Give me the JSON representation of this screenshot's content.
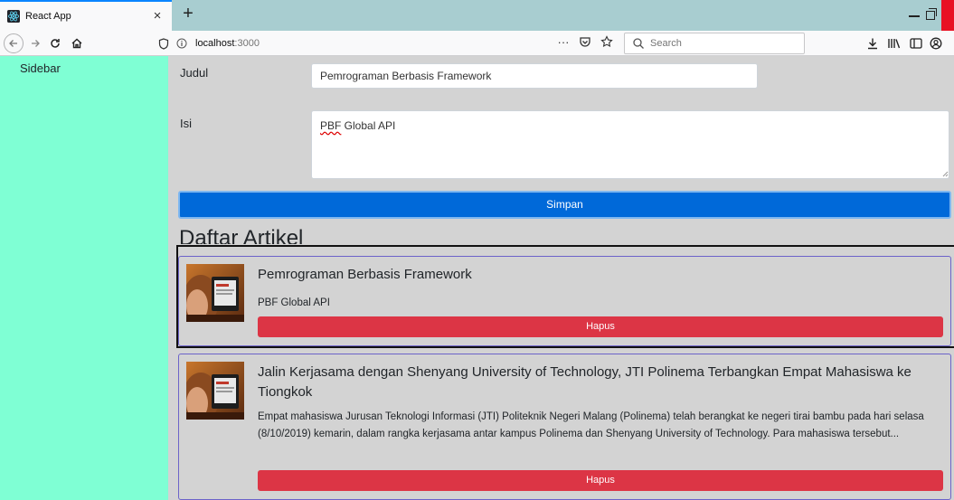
{
  "browser": {
    "tab_title": "React App",
    "tab_close": "×",
    "new_tab": "+",
    "url_host": "localhost",
    "url_port": ":3000",
    "url_more": "···",
    "search_placeholder": "Search",
    "accent_color": "#0a84ff",
    "icons": [
      "react-logo-icon",
      "back-arrow-icon",
      "forward-arrow-icon",
      "reload-icon",
      "home-icon",
      "shield-icon",
      "info-icon",
      "pocket-icon",
      "star-icon",
      "search-icon",
      "download-icon",
      "library-icon",
      "sidebar-icon",
      "account-icon"
    ]
  },
  "sidebar": {
    "title": "Sidebar",
    "background_color": "#7fffd4"
  },
  "form": {
    "judul_label": "Judul",
    "judul_value": "Pemrograman Berbasis Framework",
    "isi_label": "Isi",
    "isi_value_prefix": "PBF",
    "isi_value_rest": " Global API",
    "submit_label": "Simpan",
    "submit_color": "#0069d9"
  },
  "articles_section": {
    "title": "Daftar Artikel",
    "items": [
      {
        "title": "Pemrograman Berbasis Framework",
        "body": "PBF Global API",
        "delete_label": "Hapus"
      },
      {
        "title": "Jalin Kerjasama dengan Shenyang University of Technology, JTI Polinema Terbangkan Empat Mahasiswa ke Tiongkok",
        "body": "Empat mahasiswa Jurusan Teknologi Informasi (JTI) Politeknik Negeri Malang (Polinema) telah berangkat ke negeri tirai bambu pada hari selasa (8/10/2019) kemarin, dalam rangka kerjasama antar kampus Polinema dan Shenyang University of Technology. Para mahasiswa tersebut...",
        "delete_label": "Hapus"
      }
    ],
    "delete_color": "#dc3545"
  }
}
